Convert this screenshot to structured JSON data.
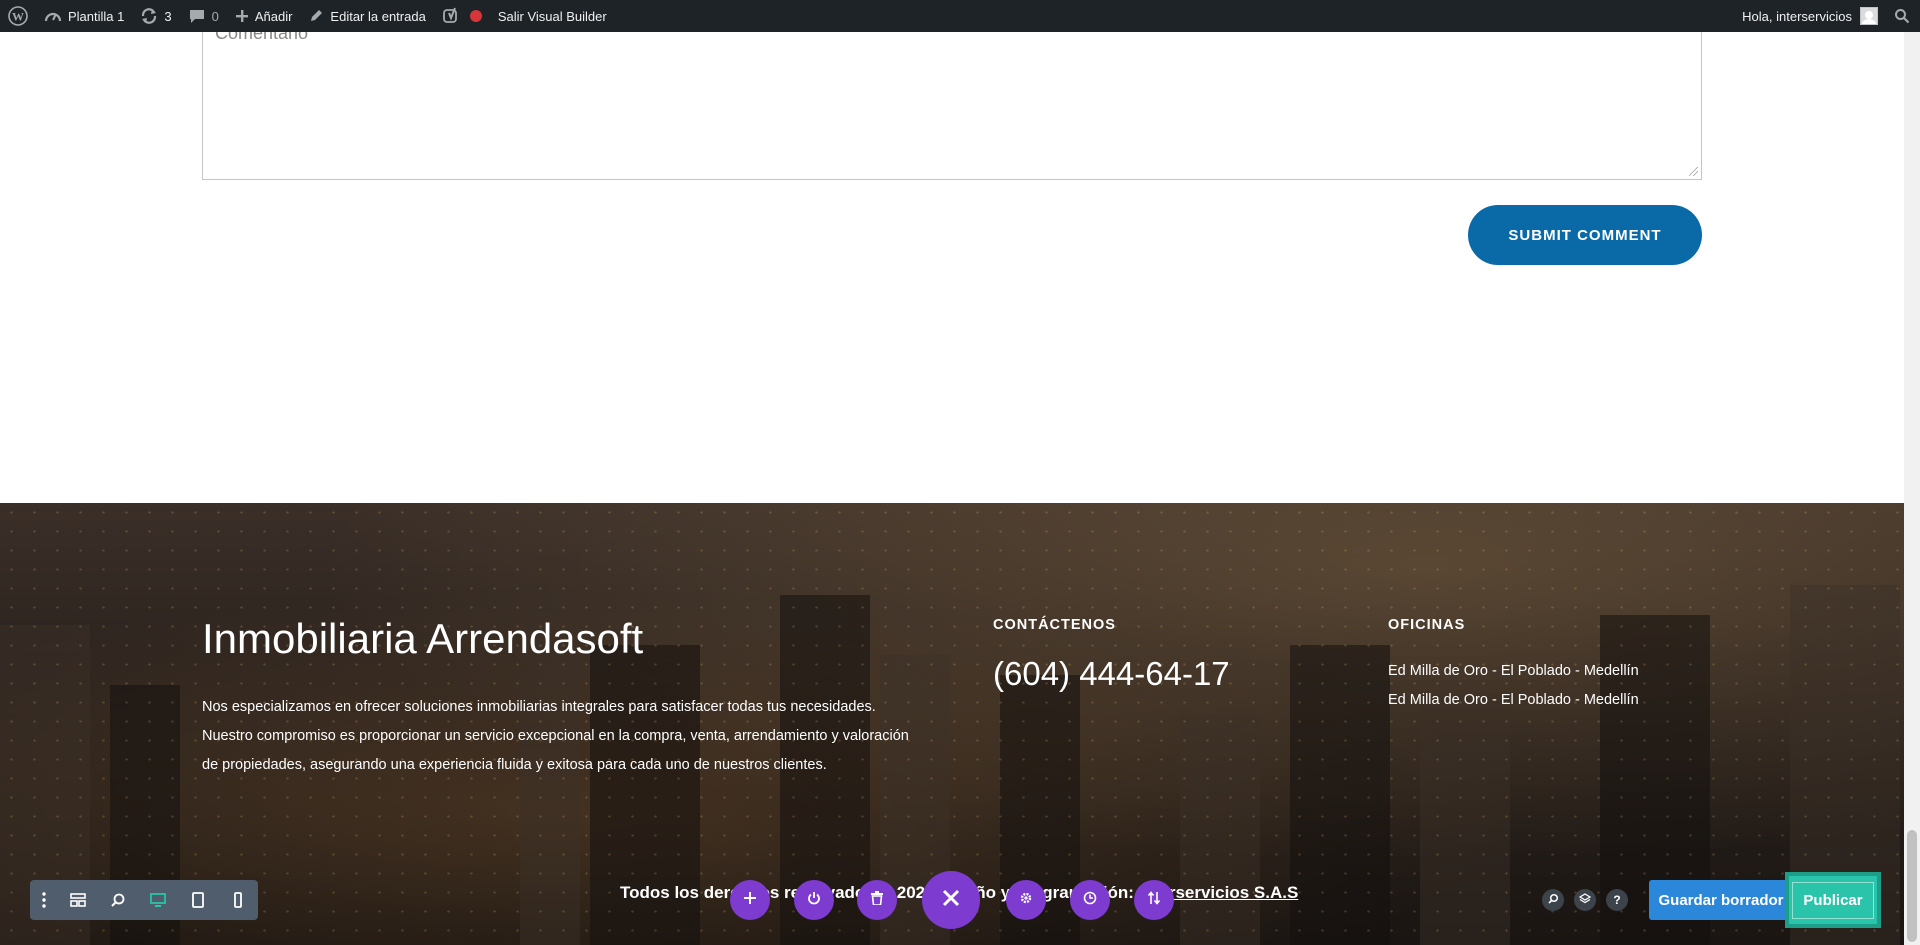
{
  "admin_bar": {
    "site_name": "Plantilla 1",
    "updates_count": "3",
    "comments_count": "0",
    "add_label": "Añadir",
    "edit_label": "Editar la entrada",
    "exit_builder_label": "Salir Visual Builder",
    "greeting": "Hola, interservicios"
  },
  "comment_form": {
    "placeholder": "Comentario",
    "submit_label": "SUBMIT COMMENT"
  },
  "footer": {
    "title": "Inmobiliaria Arrendasoft",
    "description": "Nos especializamos en ofrecer soluciones inmobiliarias integrales para satisfacer todas tus necesidades. Nuestro compromiso es proporcionar un servicio excepcional en la compra, venta, arrendamiento y valoración de propiedades, asegurando una experiencia fluida y exitosa para cada uno de nuestros clientes.",
    "contact_heading": "CONTÁCTENOS",
    "phone": "(604) 444-64-17",
    "offices_heading": "OFICINAS",
    "offices": [
      "Ed Milla de Oro - El Poblado - Medellín",
      "Ed Milla de Oro - El Poblado - Medellín"
    ],
    "copyright_text": "Todos los derechos reservados © 2024 Diseño y programación: ",
    "copyright_link": "Interservicios S.A.S"
  },
  "builder": {
    "save_draft_label": "Guardar borrador",
    "publish_label": "Publicar",
    "help_label": "?"
  },
  "colors": {
    "admin_bar": "#1d2327",
    "submit_button": "#0a6aa8",
    "builder_purple": "#7e3bd0",
    "save_draft": "#2b87da",
    "publish": "#29c4a9"
  }
}
